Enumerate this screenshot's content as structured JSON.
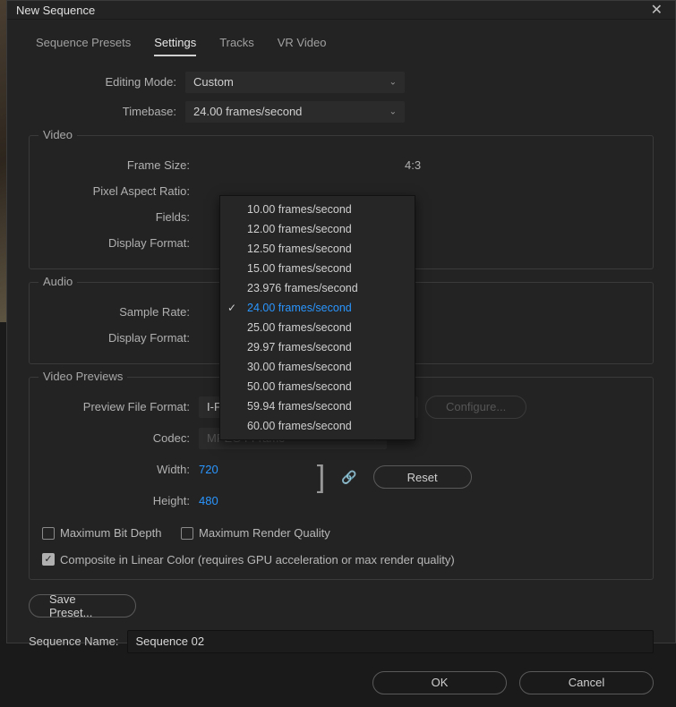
{
  "dialog": {
    "title": "New Sequence"
  },
  "tabs": {
    "presets": "Sequence Presets",
    "settings": "Settings",
    "tracks": "Tracks",
    "vr": "VR Video"
  },
  "labels": {
    "editingMode": "Editing Mode:",
    "timebase": "Timebase:",
    "frameSize": "Frame Size:",
    "pixelAspect": "Pixel Aspect Ratio:",
    "fields": "Fields:",
    "displayFormat": "Display Format:",
    "sampleRate": "Sample Rate:",
    "audioDisplayFormat": "Display Format:",
    "previewFileFormat": "Preview File Format:",
    "codec": "Codec:",
    "width": "Width:",
    "height": "Height:",
    "sequenceName": "Sequence Name:"
  },
  "groups": {
    "video": "Video",
    "audio": "Audio",
    "previews": "Video Previews"
  },
  "values": {
    "editingMode": "Custom",
    "timebase": "24.00  frames/second",
    "ratioText": "4:3",
    "previewFileFormat": "I-Frame Only MPEG",
    "codec": "MPEG I-Frame",
    "width": "720",
    "height": "480",
    "sequenceName": "Sequence 02"
  },
  "timebaseOptions": [
    "10.00  frames/second",
    "12.00  frames/second",
    "12.50  frames/second",
    "15.00  frames/second",
    "23.976  frames/second",
    "24.00  frames/second",
    "25.00  frames/second",
    "29.97  frames/second",
    "30.00  frames/second",
    "50.00  frames/second",
    "59.94  frames/second",
    "60.00  frames/second"
  ],
  "timebaseSelectedIndex": 5,
  "checkboxes": {
    "maxBitDepth": "Maximum Bit Depth",
    "maxRenderQuality": "Maximum Render Quality",
    "compositeLinear": "Composite in Linear Color (requires GPU acceleration or max render quality)"
  },
  "buttons": {
    "configure": "Configure...",
    "reset": "Reset",
    "savePreset": "Save Preset...",
    "ok": "OK",
    "cancel": "Cancel"
  }
}
